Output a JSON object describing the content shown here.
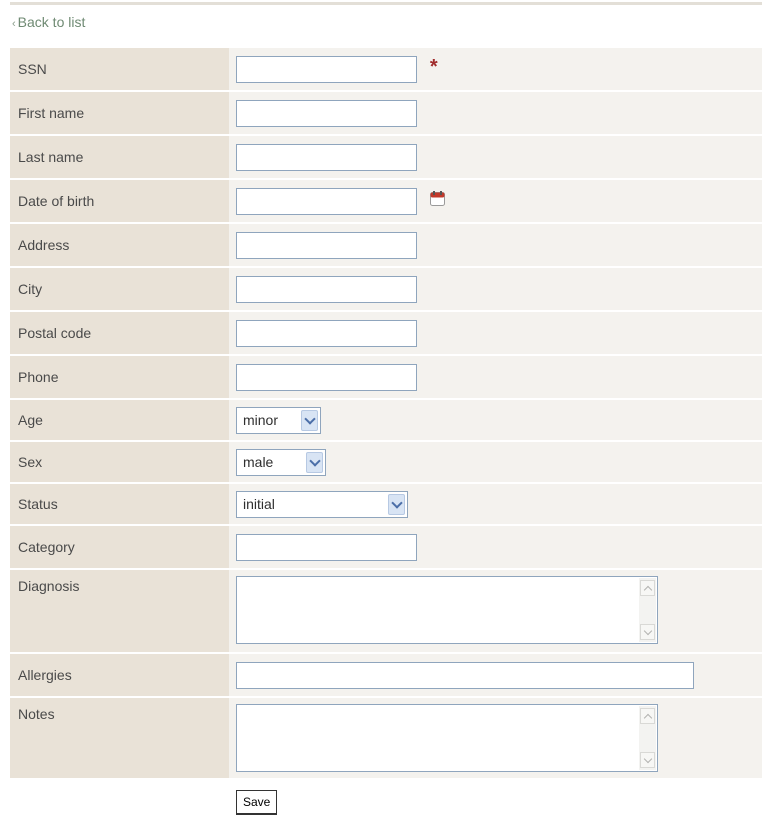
{
  "nav": {
    "back_label": "Back to list",
    "back_chevron": "‹"
  },
  "fields": {
    "ssn": {
      "label": "SSN",
      "value": ""
    },
    "first_name": {
      "label": "First name",
      "value": ""
    },
    "last_name": {
      "label": "Last name",
      "value": ""
    },
    "dob": {
      "label": "Date of birth",
      "value": ""
    },
    "address": {
      "label": "Address",
      "value": ""
    },
    "city": {
      "label": "City",
      "value": ""
    },
    "postal_code": {
      "label": "Postal code",
      "value": ""
    },
    "phone": {
      "label": "Phone",
      "value": ""
    },
    "age": {
      "label": "Age",
      "selected": "minor"
    },
    "sex": {
      "label": "Sex",
      "selected": "male"
    },
    "status": {
      "label": "Status",
      "selected": "initial"
    },
    "category": {
      "label": "Category",
      "value": ""
    },
    "diagnosis": {
      "label": "Diagnosis",
      "value": ""
    },
    "allergies": {
      "label": "Allergies",
      "value": ""
    },
    "notes": {
      "label": "Notes",
      "value": ""
    }
  },
  "required_mark": "*",
  "icons": {
    "required": "required-asterisk-icon",
    "calendar": "calendar-icon"
  },
  "actions": {
    "save_label": "Save"
  },
  "colors": {
    "label_bg": "#e9e2d7",
    "field_bg": "#f4f2ee",
    "input_border": "#8fa5bd",
    "required": "#a02c2c",
    "link": "#6f8a73"
  }
}
